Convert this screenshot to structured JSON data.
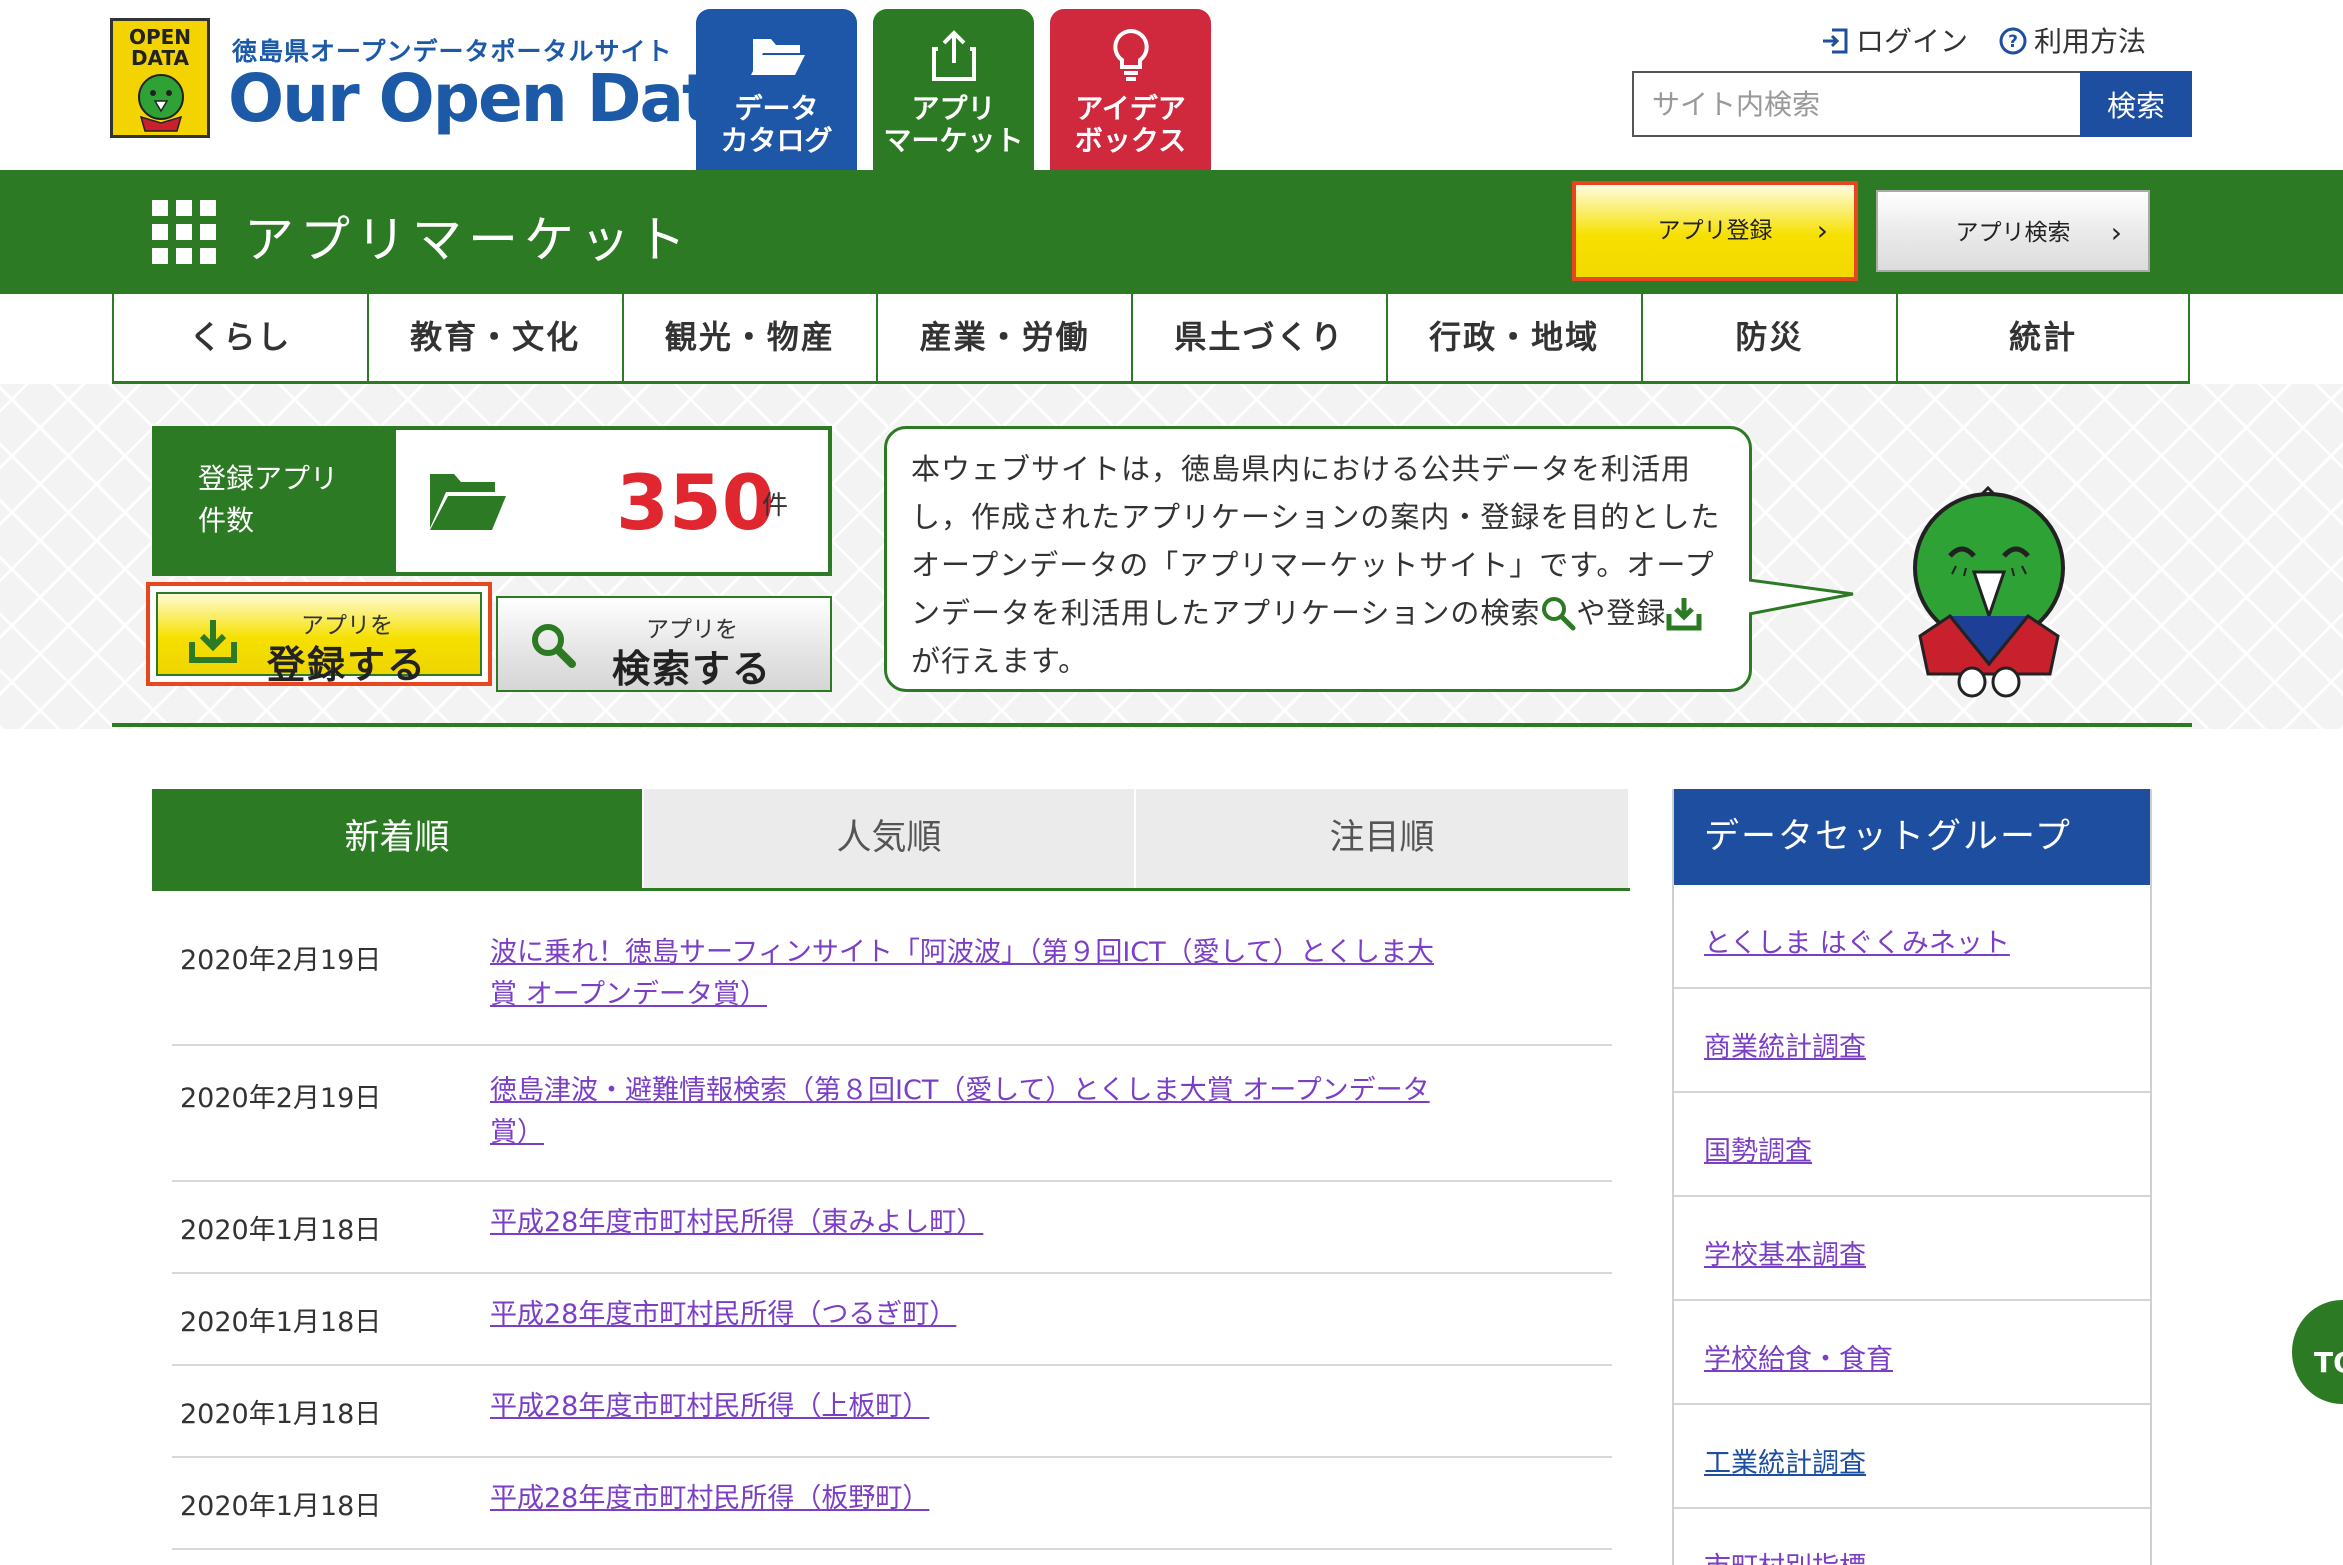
{
  "header": {
    "logo_badge": "OPEN\nDATA",
    "logo_subtitle": "徳島県オープンデータポータルサイト",
    "logo_title": "Our Open Data",
    "tabs": [
      {
        "label": "データ\nカタログ",
        "color": "#1e57a8"
      },
      {
        "label": "アプリ\nマーケット",
        "color": "#2c7a24"
      },
      {
        "label": "アイデア\nボックス",
        "color": "#d0283c"
      }
    ],
    "login": "ログイン",
    "howto": "利用方法",
    "search": {
      "placeholder": "サイト内検索",
      "button": "検索"
    }
  },
  "section": {
    "title": "アプリマーケット",
    "register_btn": "アプリ登録",
    "search_btn": "アプリ検索"
  },
  "categories": [
    "くらし",
    "教育・文化",
    "観光・物産",
    "産業・労働",
    "県土づくり",
    "行政・地域",
    "防災",
    "統計"
  ],
  "hero": {
    "count_label": "登録アプリ\n件数",
    "count": "350",
    "count_unit": "件",
    "register": {
      "small": "アプリを",
      "big": "登録する"
    },
    "search": {
      "small": "アプリを",
      "big": "検索する"
    },
    "bubble_part1": "本ウェブサイトは，徳島県内における公共データを利活用し，作成されたアプリケーションの案内・登録を目的としたオープンデータの「アプリマーケットサイト」です。オープンデータを利活用したアプリケーションの検索",
    "bubble_part2": "や登録",
    "bubble_part3": "が行えます。"
  },
  "list_tabs": [
    "新着順",
    "人気順",
    "注目順"
  ],
  "news": [
    {
      "date": "2020年2月19日",
      "title": "波に乗れ！徳島サーフィンサイト「阿波波」（第９回ICT（愛して）とくしま大賞 オープンデータ賞）"
    },
    {
      "date": "2020年2月19日",
      "title": "徳島津波・避難情報検索（第８回ICT（愛して）とくしま大賞 オープンデータ賞）"
    },
    {
      "date": "2020年1月18日",
      "title": "平成28年度市町村民所得（東みよし町）"
    },
    {
      "date": "2020年1月18日",
      "title": "平成28年度市町村民所得（つるぎ町）"
    },
    {
      "date": "2020年1月18日",
      "title": "平成28年度市町村民所得（上板町）"
    },
    {
      "date": "2020年1月18日",
      "title": "平成28年度市町村民所得（板野町）"
    }
  ],
  "sidebar": {
    "title": "データセットグループ",
    "items": [
      "とくしま はぐくみネット",
      "商業統計調査",
      "国勢調査",
      "学校基本調査",
      "学校給食・食育",
      "工業統計調査",
      "市町村別指標"
    ]
  },
  "to_top": "TO",
  "colors": {
    "green": "#2c7a24",
    "blue": "#1e4ea0",
    "red": "#d0283c",
    "highlight": "#e8461e",
    "link": "#7b3fc6"
  }
}
